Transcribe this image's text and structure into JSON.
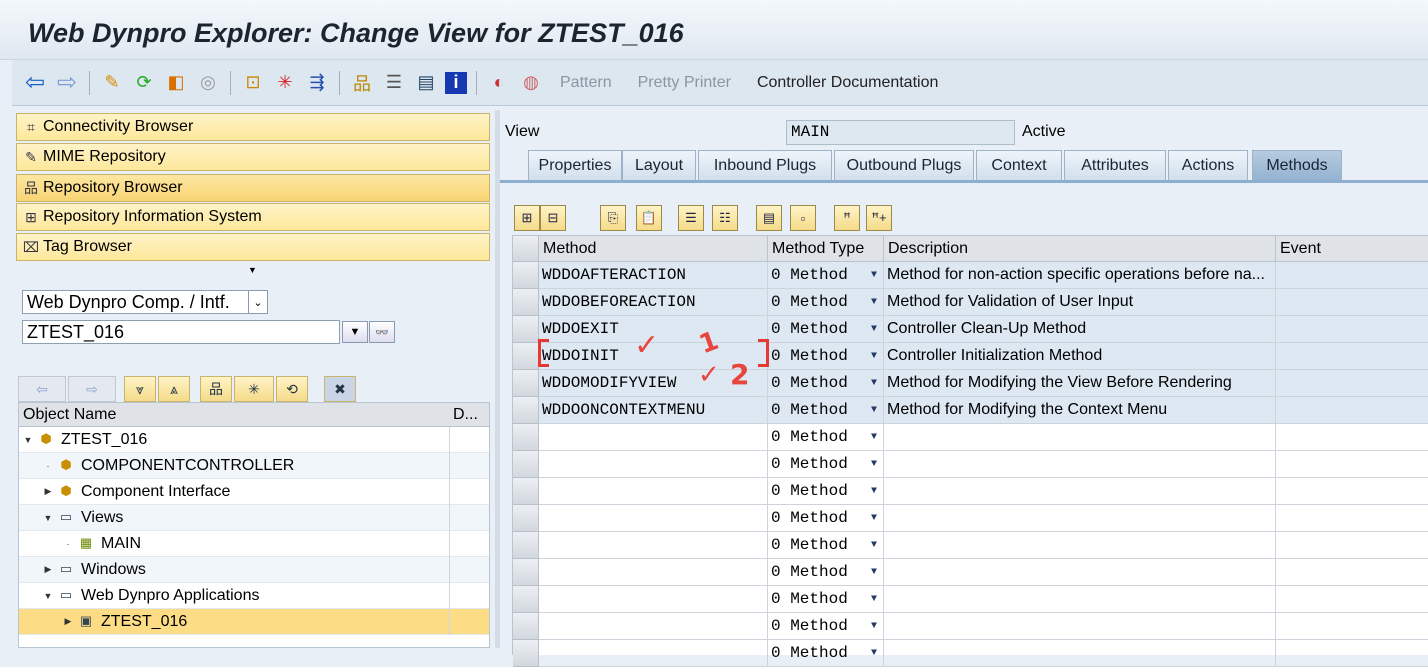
{
  "title": "Web Dynpro Explorer: Change View for ZTEST_016",
  "toolbar": {
    "pattern": "Pattern",
    "pretty_printer": "Pretty Printer",
    "controller_documentation": "Controller Documentation"
  },
  "nav": [
    {
      "label": "Connectivity Browser"
    },
    {
      "label": "MIME Repository"
    },
    {
      "label": "Repository Browser"
    },
    {
      "label": "Repository Information System"
    },
    {
      "label": "Tag Browser"
    }
  ],
  "object_type": "Web Dynpro Comp. / Intf.",
  "object_name": "ZTEST_016",
  "tree": {
    "col_name": "Object Name",
    "col_desc": "D...",
    "rows": [
      {
        "label": "ZTEST_016"
      },
      {
        "label": "COMPONENTCONTROLLER"
      },
      {
        "label": "Component Interface"
      },
      {
        "label": "Views"
      },
      {
        "label": "MAIN"
      },
      {
        "label": "Windows"
      },
      {
        "label": "Web Dynpro Applications"
      },
      {
        "label": "ZTEST_016"
      }
    ]
  },
  "view": {
    "label": "View",
    "value": "MAIN",
    "status": "Active"
  },
  "tabs": [
    "Properties",
    "Layout",
    "Inbound Plugs",
    "Outbound Plugs",
    "Context",
    "Attributes",
    "Actions",
    "Methods"
  ],
  "grid": {
    "headers": [
      "Method",
      "Method Type",
      "Description",
      "Event"
    ],
    "rows": [
      {
        "method": "WDDOAFTERACTION",
        "type": "0 Method",
        "desc": "Method for non-action specific operations before na...",
        "event": ""
      },
      {
        "method": "WDDOBEFOREACTION",
        "type": "0 Method",
        "desc": "Method for Validation of User Input",
        "event": ""
      },
      {
        "method": "WDDOEXIT",
        "type": "0 Method",
        "desc": "Controller Clean-Up Method",
        "event": ""
      },
      {
        "method": "WDDOINIT",
        "type": "0 Method",
        "desc": "Controller Initialization Method",
        "event": ""
      },
      {
        "method": "WDDOMODIFYVIEW",
        "type": "0 Method",
        "desc": "Method for Modifying the View Before Rendering",
        "event": ""
      },
      {
        "method": "WDDOONCONTEXTMENU",
        "type": "0 Method",
        "desc": "Method for Modifying the Context Menu",
        "event": ""
      },
      {
        "method": "",
        "type": "0 Method",
        "desc": "",
        "event": ""
      },
      {
        "method": "",
        "type": "0 Method",
        "desc": "",
        "event": ""
      },
      {
        "method": "",
        "type": "0 Method",
        "desc": "",
        "event": ""
      },
      {
        "method": "",
        "type": "0 Method",
        "desc": "",
        "event": ""
      },
      {
        "method": "",
        "type": "0 Method",
        "desc": "",
        "event": ""
      },
      {
        "method": "",
        "type": "0 Method",
        "desc": "",
        "event": ""
      },
      {
        "method": "",
        "type": "0 Method",
        "desc": "",
        "event": ""
      },
      {
        "method": "",
        "type": "0 Method",
        "desc": "",
        "event": ""
      },
      {
        "method": "",
        "type": "0 Method",
        "desc": "",
        "event": ""
      }
    ]
  },
  "annotations": {
    "one": "1",
    "two": "2"
  }
}
